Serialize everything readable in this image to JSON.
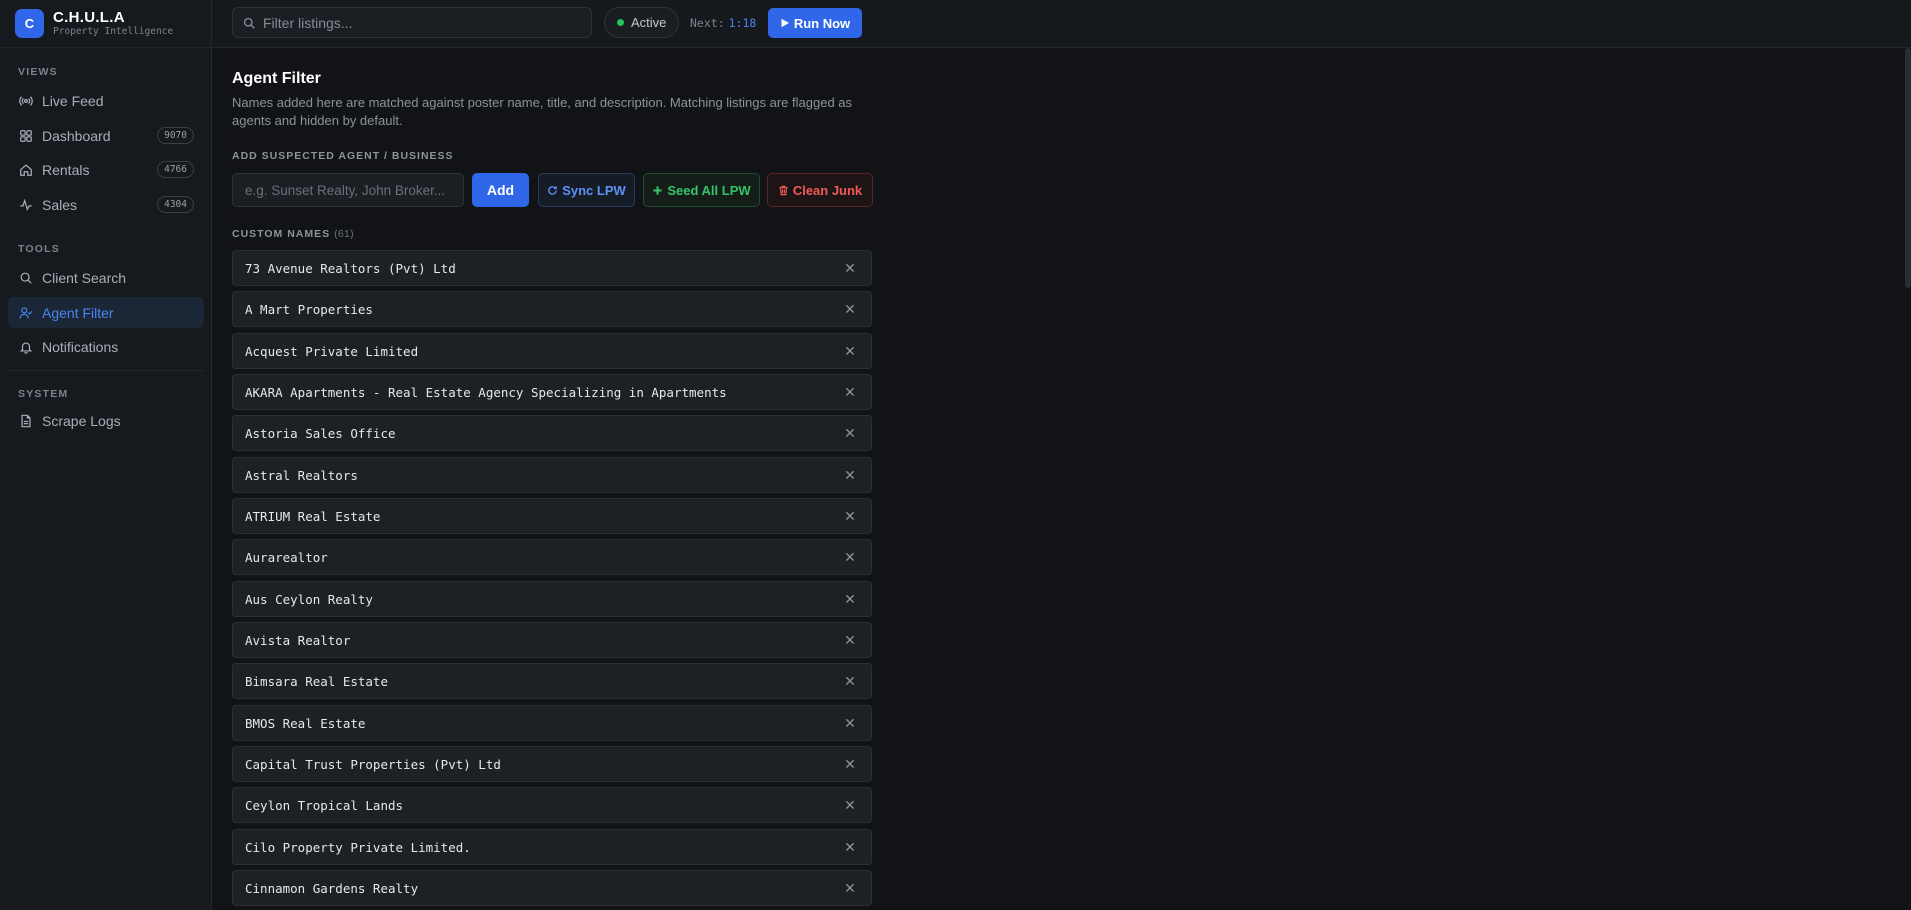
{
  "brand": {
    "logo_letter": "C",
    "name": "C.H.U.L.A",
    "subtitle": "Property Intelligence"
  },
  "sidebar": {
    "sections": [
      {
        "label": "VIEWS"
      },
      {
        "label": "TOOLS"
      },
      {
        "label": "SYSTEM"
      }
    ],
    "items": [
      {
        "label": "Live Feed",
        "icon": "broadcast-icon"
      },
      {
        "label": "Dashboard",
        "icon": "grid-icon",
        "badge": "9070"
      },
      {
        "label": "Rentals",
        "icon": "home-icon",
        "badge": "4766"
      },
      {
        "label": "Sales",
        "icon": "activity-icon",
        "badge": "4304"
      },
      {
        "label": "Client Search",
        "icon": "search-icon"
      },
      {
        "label": "Agent Filter",
        "icon": "user-check-icon",
        "active": true
      },
      {
        "label": "Notifications",
        "icon": "bell-icon"
      },
      {
        "label": "Scrape Logs",
        "icon": "file-icon"
      }
    ]
  },
  "topbar": {
    "search_placeholder": "Filter listings...",
    "status": "Active",
    "status_color": "#22c55e",
    "next_label": "Next:",
    "next_time": "1:18",
    "run_label": "Run Now"
  },
  "main": {
    "title": "Agent Filter",
    "description": "Names added here are matched against poster name, title, and description. Matching listings are flagged as agents and hidden by default.",
    "add_label": "ADD SUSPECTED AGENT / BUSINESS",
    "input_placeholder": "e.g. Sunset Realty, John Broker...",
    "buttons": {
      "add": "Add",
      "sync": "Sync LPW",
      "seed": "Seed All LPW",
      "clean": "Clean Junk"
    },
    "custom_label": "CUSTOM NAMES",
    "custom_count": "(61)",
    "names": [
      "73 Avenue Realtors (Pvt) Ltd",
      "A Mart Properties",
      "Acquest Private Limited",
      "AKARA Apartments - Real Estate Agency Specializing in Apartments",
      "Astoria Sales Office",
      "Astral Realtors",
      "ATRIUM Real Estate",
      "Aurarealtor",
      "Aus Ceylon Realty",
      "Avista Realtor",
      "Bimsara Real Estate",
      "BMOS Real Estate",
      "Capital Trust Properties (Pvt) Ltd",
      "Ceylon Tropical Lands",
      "Cilo Property Private Limited.",
      "Cinnamon Gardens Realty"
    ]
  },
  "colors": {
    "accent": "#2f67e8",
    "success": "#36c46b",
    "danger": "#ef5a5a",
    "background": "#111316"
  }
}
